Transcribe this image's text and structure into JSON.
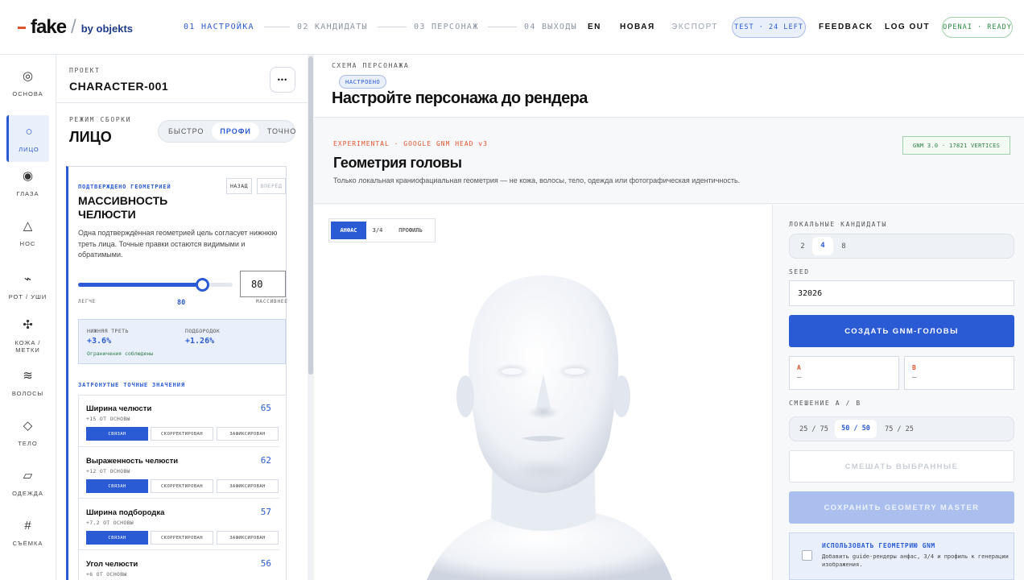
{
  "header": {
    "logo_word": "fake",
    "logo_by": "by objekts",
    "steps": [
      {
        "label": "01 НАСТРОЙКА"
      },
      {
        "label": "02 КАНДИДАТЫ"
      },
      {
        "label": "03 ПЕРСОНАЖ"
      },
      {
        "label": "04 ВЫХОДЫ"
      }
    ],
    "lang": "EN",
    "new": "НОВАЯ",
    "export": "ЭКСПОРТ",
    "test_pill": "TEST · 24 LEFT",
    "feedback": "FEEDBACK",
    "logout": "LOG OUT",
    "status_pill": "OPENAI · READY",
    "accent": "#2b5bd4"
  },
  "rail": {
    "items": [
      {
        "icon": "target-icon",
        "glyph": "◎",
        "label": "ОСНОВА"
      },
      {
        "icon": "circle-icon",
        "glyph": "○",
        "label": "ЛИЦО"
      },
      {
        "icon": "eye-icon",
        "glyph": "◉",
        "label": "ГЛАЗА"
      },
      {
        "icon": "triangle-icon",
        "glyph": "△",
        "label": "НОС"
      },
      {
        "icon": "mouth-icon",
        "glyph": "⌁",
        "label": "РОТ / УШИ"
      },
      {
        "icon": "move-icon",
        "glyph": "✣",
        "label": "КОЖА / МЕТКИ"
      },
      {
        "icon": "waves-icon",
        "glyph": "≋",
        "label": "ВОЛОСЫ"
      },
      {
        "icon": "diamond-icon",
        "glyph": "◇",
        "label": "ТЕЛО"
      },
      {
        "icon": "parallelogram-icon",
        "glyph": "▱",
        "label": "ОДЕЖДА"
      },
      {
        "icon": "grid-icon",
        "glyph": "#",
        "label": "СЪЁМКА"
      }
    ]
  },
  "panel": {
    "project_label": "ПРОЕКТ",
    "project_name": "CHARACTER-001",
    "more": "•••",
    "mode_label": "РЕЖИМ СБОРКИ",
    "mode_title": "ЛИЦО",
    "modes": [
      "БЫСТРО",
      "ПРОФИ",
      "ТОЧНО"
    ],
    "card": {
      "tag": "ПОДТВЕРЖДЕНО ГЕОМЕТРИЕЙ",
      "back": "НАЗАД",
      "forward": "ВПЕРЁД",
      "title": "МАССИВНОСТЬ ЧЕЛЮСТИ",
      "desc": "Одна подтверждённая геометрией цель согласует нижнюю треть лица. Точные правки остаются видимыми и обратимыми.",
      "slider_value": 80,
      "slider_fraction": 0.8,
      "value_box": "80",
      "min_label": "ЛЕГЧЕ",
      "max_label": "МАССИВНЕЕ",
      "stats": [
        {
          "label": "НИЖНЯЯ ТРЕТЬ",
          "value": "+3.6%"
        },
        {
          "label": "ПОДБОРОДОК",
          "value": "+1.26%"
        }
      ],
      "constraint": "Ограничения соблюдены",
      "affected_label": "ЗАТРОНУТЫЕ ТОЧНЫЕ ЗНАЧЕНИЯ",
      "rows": [
        {
          "name": "Ширина челюсти",
          "sub": "+15 ОТ ОСНОВЫ",
          "value": "65"
        },
        {
          "name": "Выраженность челюсти",
          "sub": "+12 ОТ ОСНОВЫ",
          "value": "62"
        },
        {
          "name": "Ширина подбородка",
          "sub": "+7.2 ОТ ОСНОВЫ",
          "value": "57"
        },
        {
          "name": "Угол челюсти",
          "sub": "+6 ОТ ОСНОВЫ",
          "value": "56"
        }
      ],
      "chips": [
        "СВЯЗАН",
        "СКОРРЕКТИРОВАН",
        "ЗАФИКСИРОВАН"
      ]
    }
  },
  "main": {
    "schema_label": "СХЕМА ПЕРСОНАЖА",
    "badge": "НАСТРОЕНО",
    "title": "Настройте персонажа до рендера",
    "experimental": "EXPERIMENTAL · GOOGLE GNM HEAD v3",
    "gnm_badge": "GNM 3.0 · 17821 VERTICES",
    "section_title": "Геометрия головы",
    "section_desc": "Только локальная краниофациальная геометрия — не кожа, волосы, тело, одежда или фотографическая идентичность.",
    "views": [
      "АНФАС",
      "3/4",
      "ПРОФИЛЬ"
    ],
    "side": {
      "candidates_label": "ЛОКАЛЬНЫЕ КАНДИДАТЫ",
      "candidates": [
        "2",
        "4",
        "8"
      ],
      "seed_label": "SEED",
      "seed": "32026",
      "create": "СОЗДАТЬ GNM-ГОЛОВЫ",
      "a_label": "A",
      "a_value": "—",
      "b_label": "B",
      "b_value": "—",
      "mix_label": "СМЕШЕНИЕ A / B",
      "mixes": [
        "25 / 75",
        "50 / 50",
        "75 / 25"
      ],
      "mix_btn": "СМЕШАТЬ ВЫБРАННЫЕ",
      "save_btn": "СОХРАНИТЬ GEOMETRY MASTER",
      "use_title": "ИСПОЛЬЗОВАТЬ ГЕОМЕТРИЮ GNM",
      "use_desc": "Добавить guide-рендеры анфас, 3/4 и профиль к генерации изображения."
    }
  }
}
